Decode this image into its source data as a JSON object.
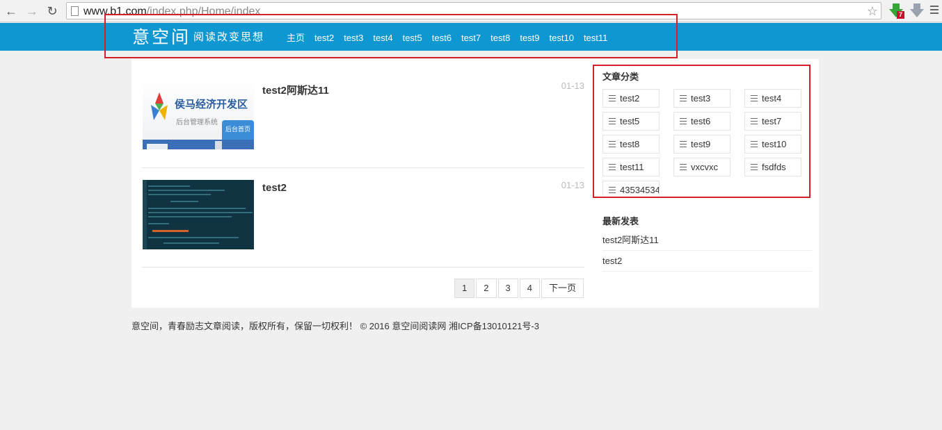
{
  "browser": {
    "url_host": "www.b1.com",
    "url_path": "/index.php/Home/index",
    "ext_badge": "7"
  },
  "header": {
    "logo_main": "意空间",
    "logo_tagline": "阅读改变思想",
    "nav": [
      "主页",
      "test2",
      "test3",
      "test4",
      "test5",
      "test6",
      "test7",
      "test8",
      "test9",
      "test10",
      "test11"
    ]
  },
  "posts": [
    {
      "title": "test2阿斯达11",
      "date": "01-13",
      "thumb_title": "侯马经济开发区",
      "thumb_sub": "后台管理系统",
      "thumb_btn": "后台首页"
    },
    {
      "title": "test2",
      "date": "01-13"
    }
  ],
  "pagination": [
    "1",
    "2",
    "3",
    "4",
    "下一页"
  ],
  "sidebar": {
    "categories_title": "文章分类",
    "categories": [
      "test2",
      "test3",
      "test4",
      "test5",
      "test6",
      "test7",
      "test8",
      "test9",
      "test10",
      "test11",
      "vxcvxc",
      "fsdfds",
      "43534534"
    ],
    "recent_title": "最新发表",
    "recent": [
      "test2阿斯达11",
      "test2"
    ]
  },
  "footer": "意空间，青春励志文章阅读，版权所有，保留一切权利！ © 2016 意空间阅读网 湘ICP备13010121号-3",
  "colors": {
    "header_bg": "#0e97d1",
    "highlight_border": "#d31f25"
  }
}
